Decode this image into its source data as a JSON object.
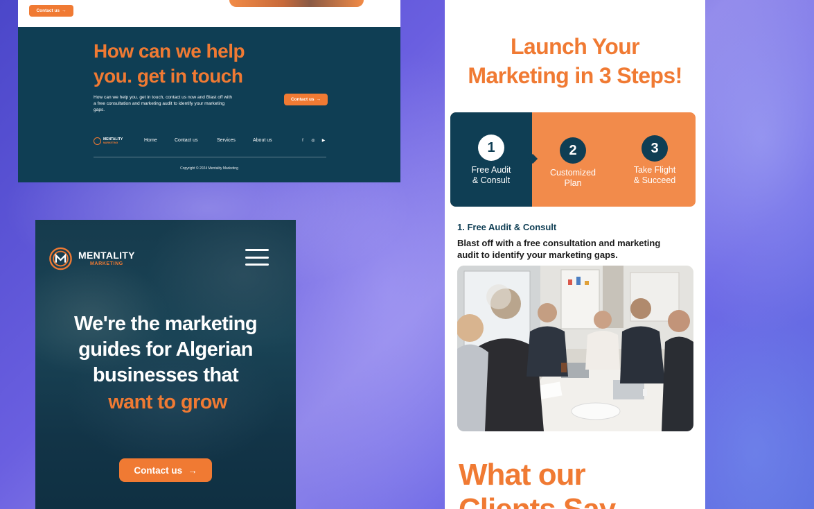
{
  "colors": {
    "accent": "#f07a33",
    "navy": "#0f3e54",
    "white": "#ffffff"
  },
  "contact_panel": {
    "top_button_label": "Contact us",
    "title_line1": "How can we help",
    "title_line2": "you. get in touch",
    "description": "How can we help you. get in touch, contact us now and Blast off with a free consultation and marketing audit to identify your marketing gaps.",
    "cta_label": "Contact us",
    "logo_name": "MENTALITY",
    "logo_sub": "MARKETING",
    "nav": [
      "Home",
      "Contact us",
      "Services",
      "About us"
    ],
    "social_icons": [
      "facebook-icon",
      "instagram-icon",
      "youtube-icon"
    ],
    "copyright": "Copyright © 2024 Mentality Marketing"
  },
  "mobile_hero": {
    "logo_name": "MENTALITY",
    "logo_sub": "MARKETING",
    "heading_line1": "We're the marketing",
    "heading_line2": "guides for Algerian",
    "heading_line3": "businesses that",
    "heading_highlight": "want to grow",
    "cta_label": "Contact us"
  },
  "steps_panel": {
    "title_line1": "Launch Your",
    "title_line2": "Marketing in 3 Steps!",
    "steps": [
      {
        "number": "1",
        "line1": "Free Audit",
        "line2": "& Consult"
      },
      {
        "number": "2",
        "line1": "Customized",
        "line2": "Plan"
      },
      {
        "number": "3",
        "line1": "Take Flight",
        "line2": "& Succeed"
      }
    ],
    "subheading": "1. Free Audit & Consult",
    "description_line1": "Blast off with a free consultation and marketing",
    "description_line2": "audit to identify your marketing gaps.",
    "clients_line1": "What our",
    "clients_line2": "Clients Say"
  }
}
